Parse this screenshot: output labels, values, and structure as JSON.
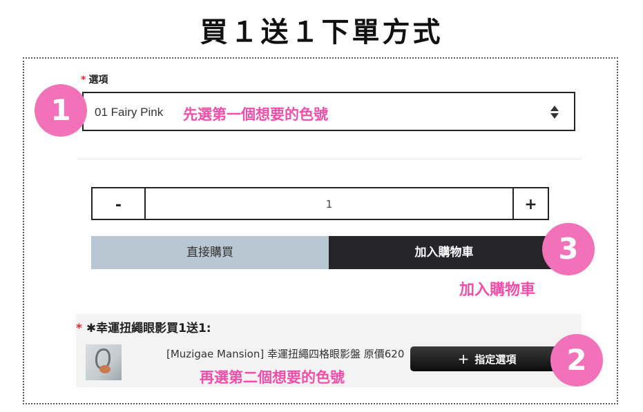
{
  "page": {
    "title": "買１送１下單方式"
  },
  "option_field": {
    "required_mark": "*",
    "label": "選項",
    "selected_value": "01 Fairy Pink"
  },
  "annotations": {
    "step1_badge": "1",
    "step1_text": "先選第一個想要的色號",
    "step2_badge": "2",
    "step2_text": "再選第二個想要的色號",
    "step3_badge": "3",
    "step3_text": "加入購物車"
  },
  "quantity": {
    "minus_label": "-",
    "value": "1",
    "plus_label": "+"
  },
  "actions": {
    "buy_now_label": "直接購買",
    "add_to_cart_label": "加入購物車"
  },
  "promo": {
    "required_mark": "*",
    "title": "✱幸運扭繩眼影買1送1:",
    "product_name": "[Muzigae Mansion] 幸運扭繩四格眼影盤 原價620",
    "assign_icon": "+",
    "assign_label": "指定選項"
  },
  "colors": {
    "annotation_pink": "#f04ea8",
    "badge_pink": "#f272b9",
    "buy_now_bg": "#b8c7d2",
    "add_cart_bg": "#25252a",
    "required_red": "#e5262b"
  },
  "icons": {
    "select_arrows": "sort-arrows-icon",
    "assign_plus": "plus-icon",
    "product_thumbnail": "product-thumbnail"
  }
}
